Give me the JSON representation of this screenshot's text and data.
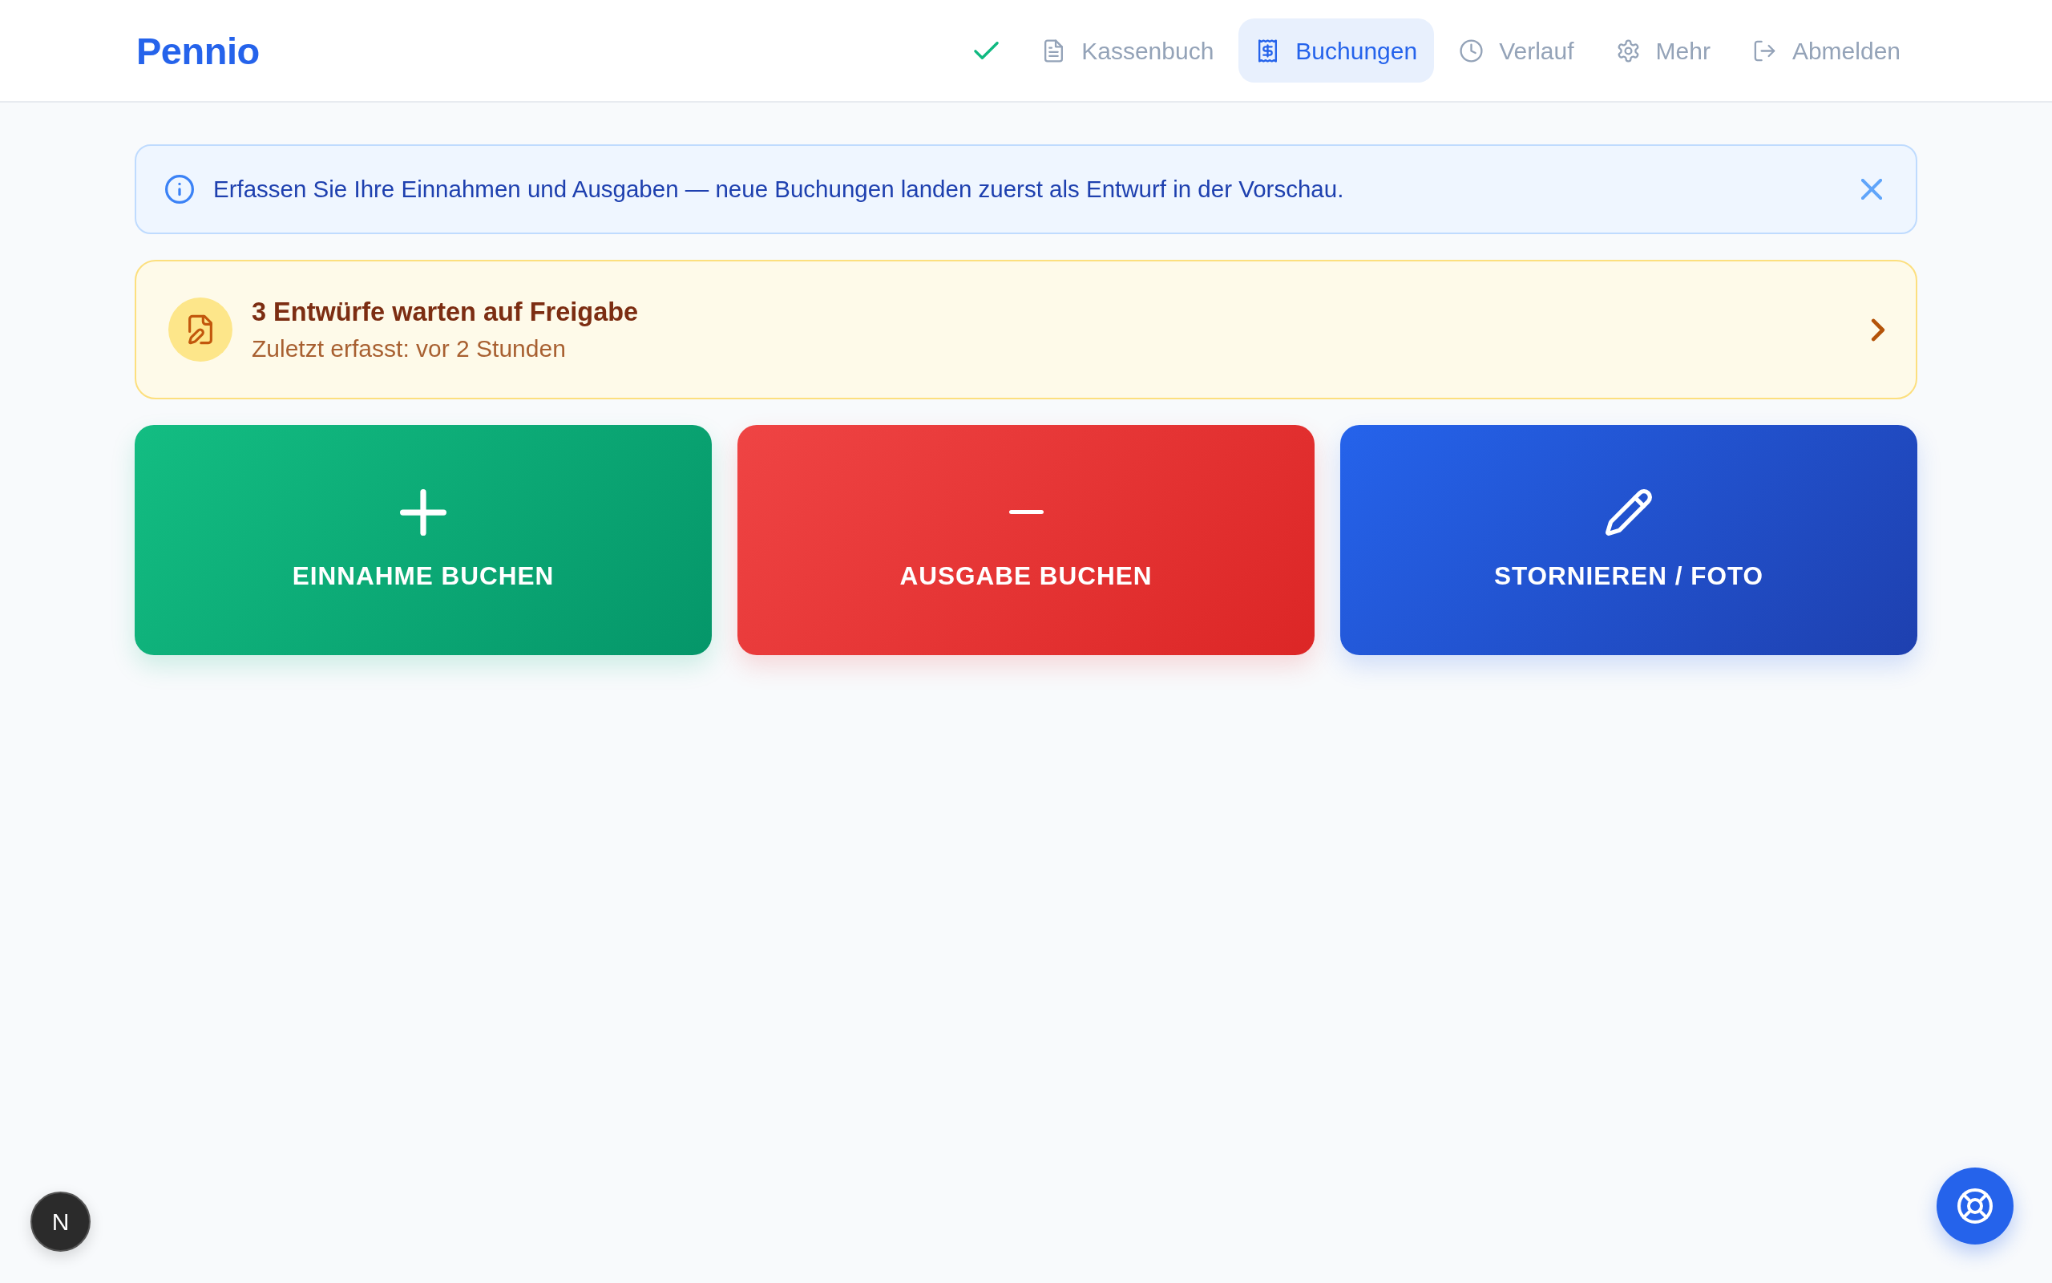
{
  "navbar": {
    "brand": "Pennio",
    "synced": true,
    "items": [
      {
        "label": "Kassenbuch",
        "selected": false
      },
      {
        "label": "Buchungen",
        "selected": true
      },
      {
        "label": "Verlauf",
        "selected": false
      },
      {
        "label": "Mehr",
        "selected": false
      },
      {
        "label": "Abmelden",
        "selected": false
      }
    ]
  },
  "info_alert": {
    "text": "Erfassen Sie Ihre Einnahmen und Ausgaben — neue Buchungen landen zuerst als Entwurf in der Vorschau.",
    "dismissible": true
  },
  "drafts_banner": {
    "title": "3 Entwürfe warten auf Freigabe",
    "subtitle": "Zuletzt erfasst: vor 2 Stunden"
  },
  "actions": [
    {
      "kind": "income",
      "label": "EINNAHME BUCHEN"
    },
    {
      "kind": "expense",
      "label": "AUSGABE BUCHEN"
    },
    {
      "kind": "correction",
      "label": "STORNIEREN / FOTO"
    }
  ],
  "dev_indicator": {
    "label": "N"
  }
}
